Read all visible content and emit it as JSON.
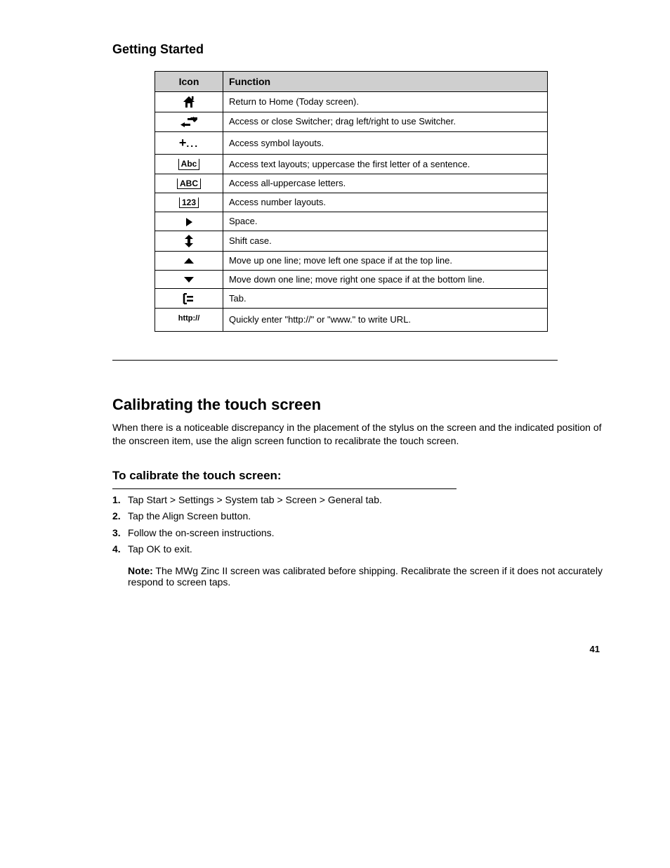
{
  "section_title": "Getting Started",
  "table": {
    "headers": [
      "Icon",
      "Function"
    ],
    "rows": [
      {
        "icon_name": "home-icon",
        "labels": [],
        "desc": "Return to Home (Today screen)."
      },
      {
        "icon_name": "switcher-icon",
        "labels": [],
        "desc": "Access or close Switcher; drag left/right to use Switcher."
      },
      {
        "icon_name": "plus-dots-icon",
        "labels": [],
        "desc": "Access symbol layouts."
      },
      {
        "icon_name": null,
        "labels": [
          "Abc"
        ],
        "desc": "Access text layouts; uppercase the first letter of a sentence."
      },
      {
        "icon_name": null,
        "labels": [
          "ABC"
        ],
        "desc": "Access all-uppercase letters."
      },
      {
        "icon_name": null,
        "labels": [
          "123"
        ],
        "desc": "Access number layouts."
      },
      {
        "icon_name": "play-icon",
        "labels": [],
        "desc": "Space."
      },
      {
        "icon_name": "up-down-icon",
        "labels": [],
        "desc": "Shift case."
      },
      {
        "icon_name": "caret-up-icon",
        "labels": [],
        "desc": "Move up one line; move left one space if at the top line."
      },
      {
        "icon_name": "caret-down-icon",
        "labels": [],
        "desc": "Move down one line; move right one space if at the bottom line."
      },
      {
        "icon_name": "tab-icon",
        "labels": [],
        "desc": "Tab."
      },
      {
        "icon_name": null,
        "labels": [
          "http://",
          "www."
        ],
        "desc": "Quickly enter \"http://\" or \"www.\" to write URL."
      }
    ],
    "labels_text": {
      "Abc": "Abc",
      "ABC": "ABC",
      "123": "123",
      "http://": "http://",
      "www.": "www."
    }
  },
  "calibrate": {
    "heading": "Calibrating the touch screen",
    "intro": "When there is a noticeable discrepancy in the placement of the stylus on the screen and the indicated position of the onscreen item, use the align screen function to recalibrate the touch screen.",
    "sub": "To calibrate the touch screen:",
    "steps": [
      "Tap Start > Settings > System tab > Screen > General tab.",
      "Tap the Align Screen button.",
      "Follow the on-screen instructions.",
      "Tap OK to exit."
    ],
    "note_label": "Note:",
    "note": "The MWg Zinc II screen was calibrated before shipping. Recalibrate the screen if it does not accurately respond to screen taps."
  },
  "footer": "41"
}
